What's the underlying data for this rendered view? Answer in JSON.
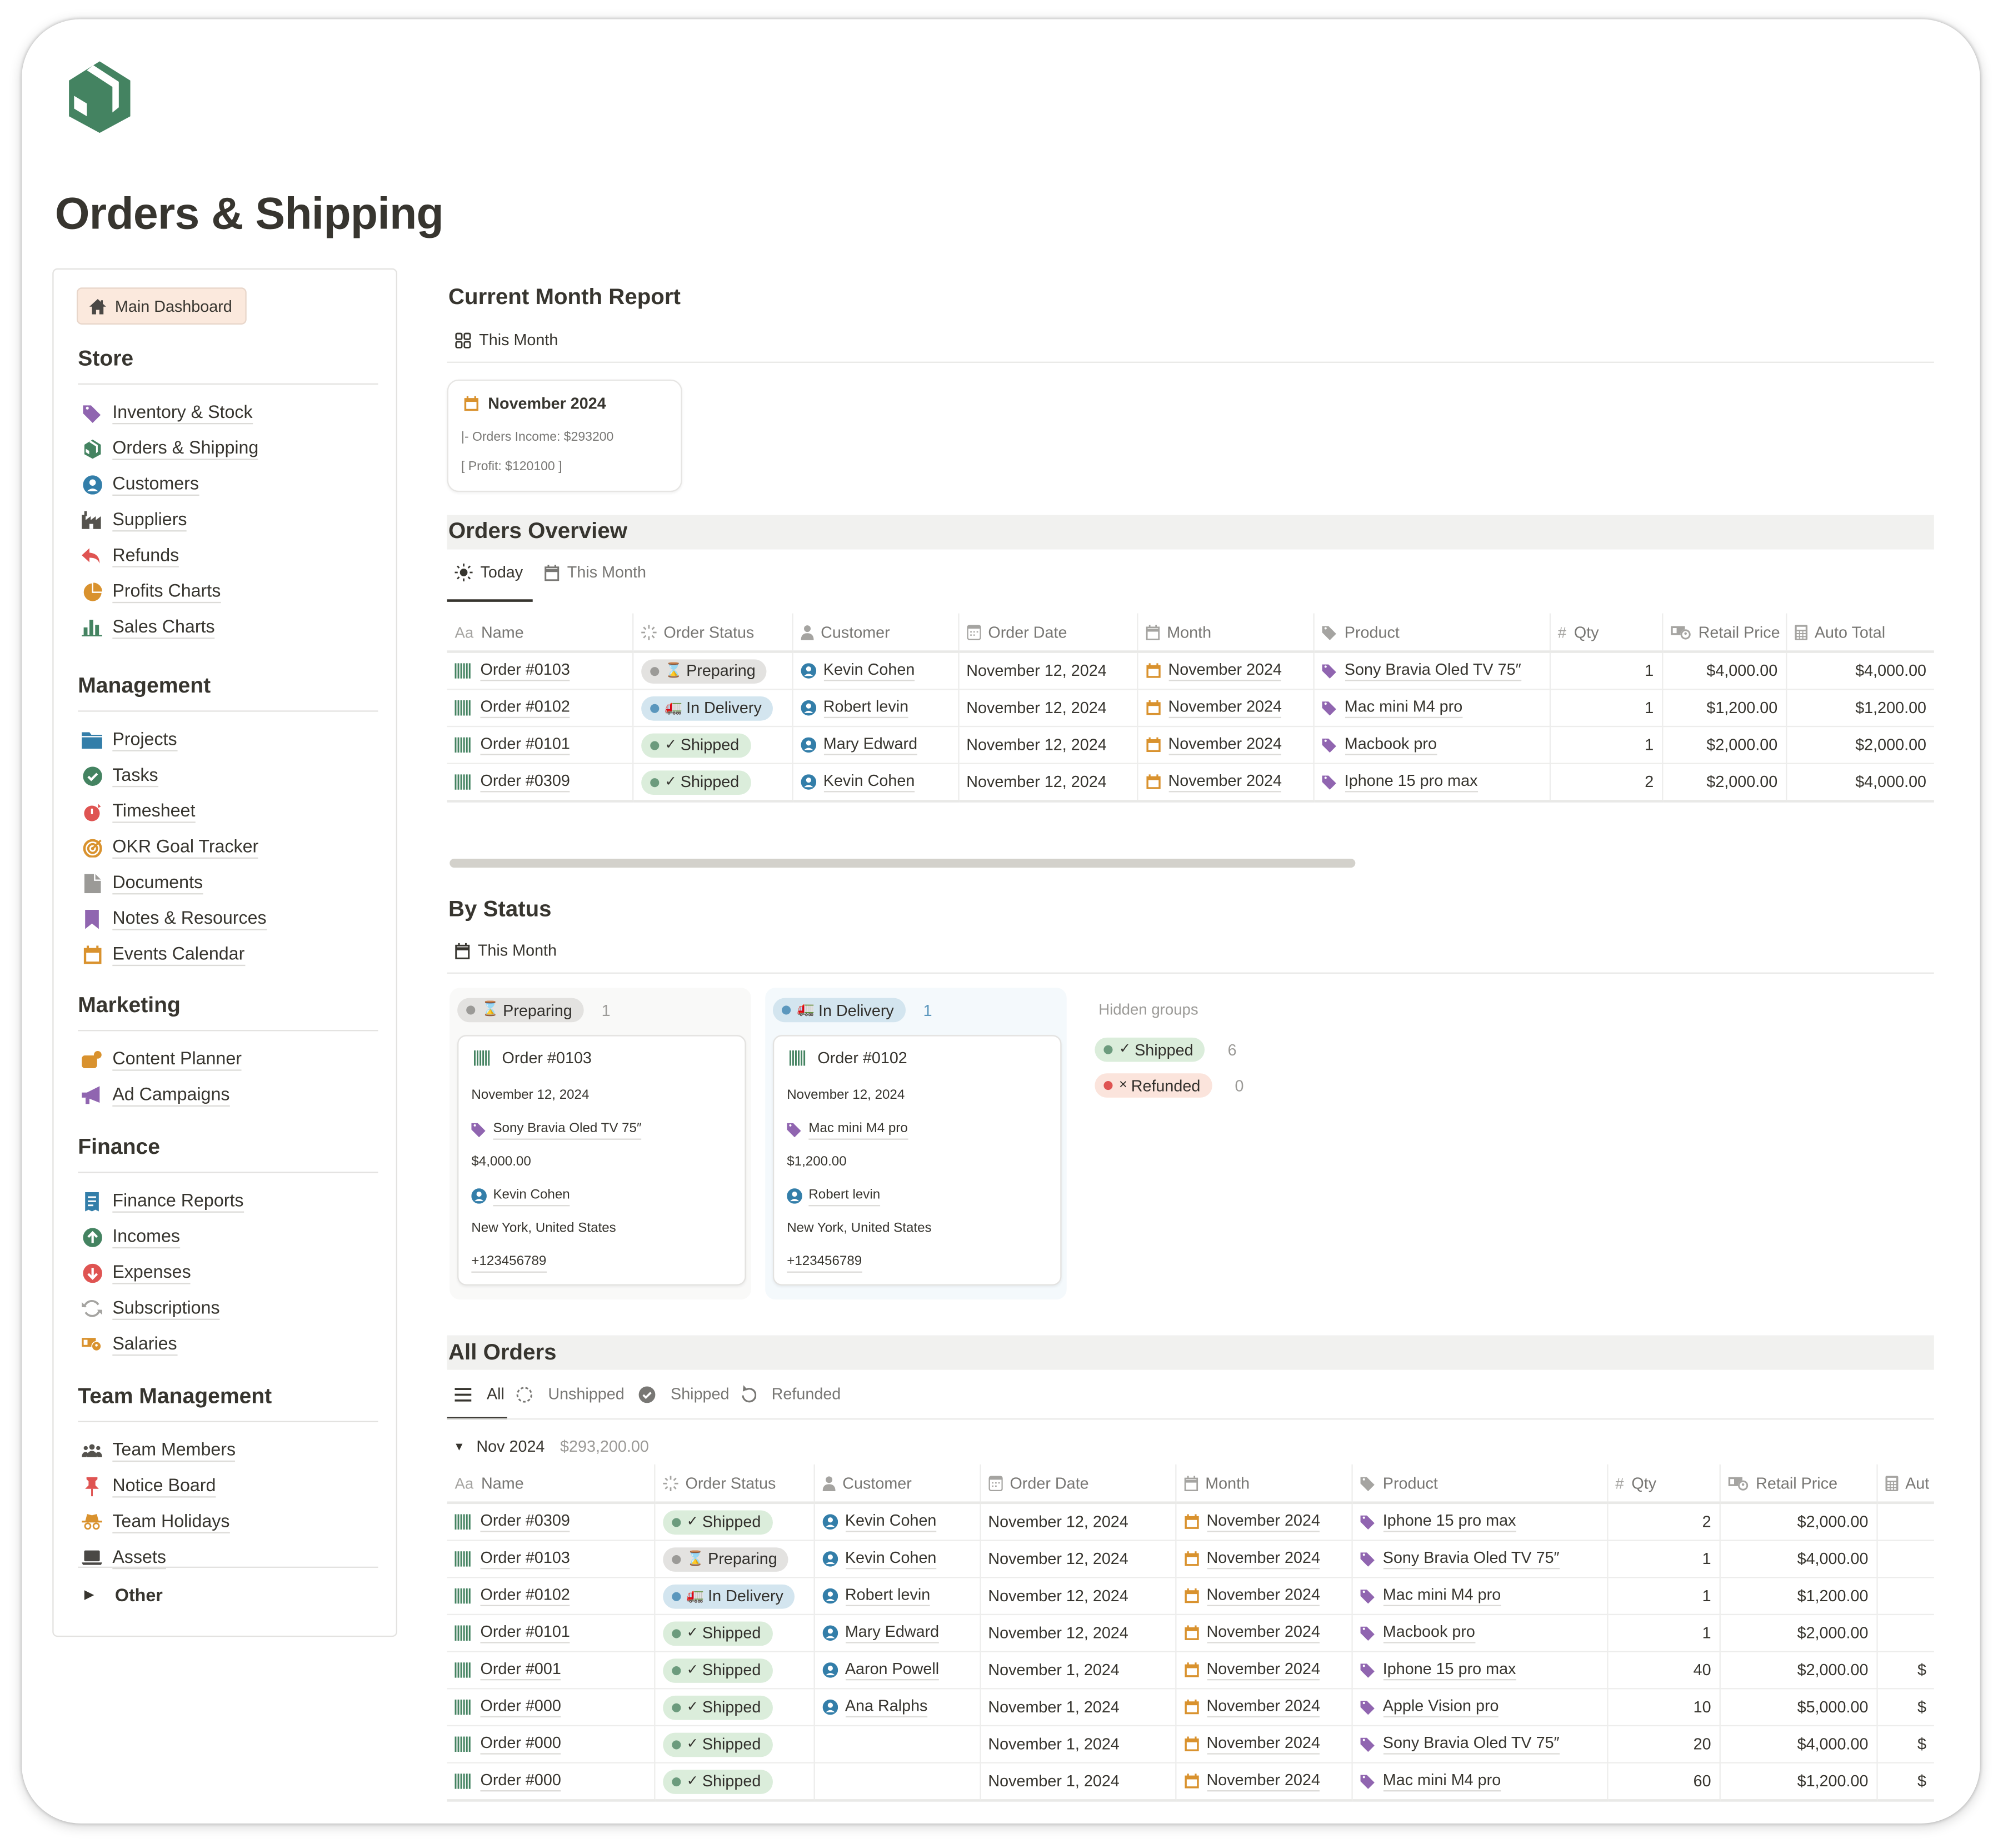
{
  "page": {
    "title": "Orders & Shipping",
    "logo_icon": "package-box-icon",
    "accent_color": "#448361"
  },
  "sidebar": {
    "home_button": {
      "label": "Main Dashboard",
      "icon": "home-icon"
    },
    "sections": [
      {
        "heading": "Store",
        "items": [
          {
            "label": "Inventory & Stock",
            "icon": "tag-icon"
          },
          {
            "label": "Orders & Shipping",
            "icon": "package-box-icon"
          },
          {
            "label": "Customers",
            "icon": "person-circle-icon"
          },
          {
            "label": "Suppliers",
            "icon": "factory-icon"
          },
          {
            "label": "Refunds",
            "icon": "reply-arrow-icon"
          },
          {
            "label": "Profits Charts",
            "icon": "pie-chart-icon"
          },
          {
            "label": "Sales Charts",
            "icon": "bar-chart-icon"
          }
        ]
      },
      {
        "heading": "Management",
        "items": [
          {
            "label": "Projects",
            "icon": "folder-icon"
          },
          {
            "label": "Tasks",
            "icon": "check-circle-icon"
          },
          {
            "label": "Timesheet",
            "icon": "stopwatch-icon"
          },
          {
            "label": "OKR Goal Tracker",
            "icon": "target-icon"
          },
          {
            "label": "Documents",
            "icon": "document-icon"
          },
          {
            "label": "Notes & Resources",
            "icon": "bookmark-icon"
          },
          {
            "label": "Events Calendar",
            "icon": "calendar-icon"
          }
        ]
      },
      {
        "heading": "Marketing",
        "items": [
          {
            "label": "Content Planner",
            "icon": "chat-bubble-icon"
          },
          {
            "label": "Ad Campaigns",
            "icon": "megaphone-icon"
          }
        ]
      },
      {
        "heading": "Finance",
        "items": [
          {
            "label": "Finance Reports",
            "icon": "receipt-icon"
          },
          {
            "label": "Incomes",
            "icon": "arrow-up-circle-icon"
          },
          {
            "label": "Expenses",
            "icon": "arrow-down-circle-icon"
          },
          {
            "label": "Subscriptions",
            "icon": "sync-icon"
          },
          {
            "label": "Salaries",
            "icon": "cash-icon"
          }
        ]
      },
      {
        "heading": "Team Management",
        "items": [
          {
            "label": "Team Members",
            "icon": "group-icon"
          },
          {
            "label": "Notice Board",
            "icon": "pushpin-icon"
          },
          {
            "label": "Team Holidays",
            "icon": "incognito-hat-icon"
          },
          {
            "label": "Assets",
            "icon": "laptop-icon"
          }
        ]
      }
    ],
    "other_toggle": {
      "label": "Other",
      "icon": "triangle-right-icon"
    }
  },
  "current_month_report": {
    "heading": "Current Month Report",
    "view_tab": {
      "label": "This Month",
      "icon": "gallery-grid-icon"
    },
    "card": {
      "title": "November 2024",
      "icon": "calendar-icon",
      "income_line": "|- Orders Income: $293200",
      "profit_line": "[ Profit: $120100 ]"
    }
  },
  "status_styles": {
    "Preparing": {
      "bg": "#e3e2e0",
      "dot": "#9b9a97",
      "emoji": "⌛"
    },
    "In Delivery": {
      "bg": "#d3e5ef",
      "dot": "#5b97bd",
      "emoji": "🚛"
    },
    "Shipped": {
      "bg": "#dbeddb",
      "dot": "#6c9b7d",
      "emoji": "✓"
    },
    "Refunded": {
      "bg": "#fbe4dc",
      "dot": "#df5452",
      "emoji": "×"
    }
  },
  "orders_overview": {
    "heading": "Orders Overview",
    "tabs": [
      {
        "label": "Today",
        "icon": "sun-icon",
        "active": true
      },
      {
        "label": "This Month",
        "icon": "calendar-icon",
        "active": false
      }
    ],
    "columns": [
      "Name",
      "Order Status",
      "Customer",
      "Order Date",
      "Month",
      "Product",
      "Qty",
      "Retail Price",
      "Auto Total"
    ],
    "rows": [
      {
        "name": "Order #0103",
        "status": "Preparing",
        "customer": "Kevin Cohen",
        "order_date": "November 12, 2024",
        "month": "November 2024",
        "product": "Sony Bravia Oled TV 75″",
        "qty": "1",
        "retail_price": "$4,000.00",
        "auto_total": "$4,000.00"
      },
      {
        "name": "Order #0102",
        "status": "In Delivery",
        "customer": "Robert levin",
        "order_date": "November 12, 2024",
        "month": "November 2024",
        "product": "Mac mini M4 pro",
        "qty": "1",
        "retail_price": "$1,200.00",
        "auto_total": "$1,200.00"
      },
      {
        "name": "Order #0101",
        "status": "Shipped",
        "customer": "Mary Edward",
        "order_date": "November 12, 2024",
        "month": "November 2024",
        "product": "Macbook pro",
        "qty": "1",
        "retail_price": "$2,000.00",
        "auto_total": "$2,000.00"
      },
      {
        "name": "Order #0309",
        "status": "Shipped",
        "customer": "Kevin Cohen",
        "order_date": "November 12, 2024",
        "month": "November 2024",
        "product": "Iphone 15 pro max",
        "qty": "2",
        "retail_price": "$2,000.00",
        "auto_total": "$4,000.00"
      }
    ],
    "scroll_position": 0
  },
  "by_status": {
    "heading": "By Status",
    "view_tab": {
      "label": "This Month",
      "icon": "calendar-icon"
    },
    "groups": [
      {
        "status": "Preparing",
        "count": "1",
        "column_bg": "#f9f9f8",
        "count_color": "#9b9a97",
        "cards": [
          {
            "name": "Order #0103",
            "date": "November 12, 2024",
            "product": "Sony Bravia Oled TV 75″",
            "price": "$4,000.00",
            "customer": "Kevin Cohen",
            "location": "New York, United States",
            "phone": "+123456789"
          }
        ]
      },
      {
        "status": "In Delivery",
        "count": "1",
        "column_bg": "#f4f9fc",
        "count_color": "#5b97bd",
        "cards": [
          {
            "name": "Order #0102",
            "date": "November 12, 2024",
            "product": "Mac mini M4 pro",
            "price": "$1,200.00",
            "customer": "Robert levin",
            "location": "New York, United States",
            "phone": "+123456789"
          }
        ]
      }
    ],
    "hidden_groups_label": "Hidden groups",
    "hidden_groups": [
      {
        "status": "Shipped",
        "count": "6"
      },
      {
        "status": "Refunded",
        "count": "0"
      }
    ]
  },
  "all_orders": {
    "heading": "All Orders",
    "tabs": [
      {
        "label": "All",
        "icon": "list-icon",
        "active": true
      },
      {
        "label": "Unshipped",
        "icon": "dashed-circle-icon",
        "active": false
      },
      {
        "label": "Shipped",
        "icon": "check-circle-icon",
        "active": false
      },
      {
        "label": "Refunded",
        "icon": "undo-icon",
        "active": false
      }
    ],
    "group": {
      "label": "Nov 2024",
      "sum": "$293,200.00",
      "expanded": true
    },
    "columns": [
      "Name",
      "Order Status",
      "Customer",
      "Order Date",
      "Month",
      "Product",
      "Qty",
      "Retail Price",
      "Aut"
    ],
    "rows": [
      {
        "name": "Order #0309",
        "status": "Shipped",
        "customer": "Kevin Cohen",
        "order_date": "November 12, 2024",
        "month": "November 2024",
        "product": "Iphone 15 pro max",
        "qty": "2",
        "retail_price": "$2,000.00",
        "auto_total": ""
      },
      {
        "name": "Order #0103",
        "status": "Preparing",
        "customer": "Kevin Cohen",
        "order_date": "November 12, 2024",
        "month": "November 2024",
        "product": "Sony Bravia Oled TV 75″",
        "qty": "1",
        "retail_price": "$4,000.00",
        "auto_total": ""
      },
      {
        "name": "Order #0102",
        "status": "In Delivery",
        "customer": "Robert levin",
        "order_date": "November 12, 2024",
        "month": "November 2024",
        "product": "Mac mini M4 pro",
        "qty": "1",
        "retail_price": "$1,200.00",
        "auto_total": ""
      },
      {
        "name": "Order #0101",
        "status": "Shipped",
        "customer": "Mary Edward",
        "order_date": "November 12, 2024",
        "month": "November 2024",
        "product": "Macbook pro",
        "qty": "1",
        "retail_price": "$2,000.00",
        "auto_total": ""
      },
      {
        "name": "Order #001",
        "status": "Shipped",
        "customer": "Aaron Powell",
        "order_date": "November 1, 2024",
        "month": "November 2024",
        "product": "Iphone 15 pro max",
        "qty": "40",
        "retail_price": "$2,000.00",
        "auto_total": "$"
      },
      {
        "name": "Order #000",
        "status": "Shipped",
        "customer": "Ana Ralphs",
        "order_date": "November 1, 2024",
        "month": "November 2024",
        "product": "Apple Vision pro",
        "qty": "10",
        "retail_price": "$5,000.00",
        "auto_total": "$"
      },
      {
        "name": "Order #000",
        "status": "Shipped",
        "customer": "",
        "order_date": "November 1, 2024",
        "month": "November 2024",
        "product": "Sony Bravia Oled TV 75″",
        "qty": "20",
        "retail_price": "$4,000.00",
        "auto_total": "$"
      },
      {
        "name": "Order #000",
        "status": "Shipped",
        "customer": "",
        "order_date": "November 1, 2024",
        "month": "November 2024",
        "product": "Mac mini M4 pro",
        "qty": "60",
        "retail_price": "$1,200.00",
        "auto_total": "$"
      }
    ]
  }
}
